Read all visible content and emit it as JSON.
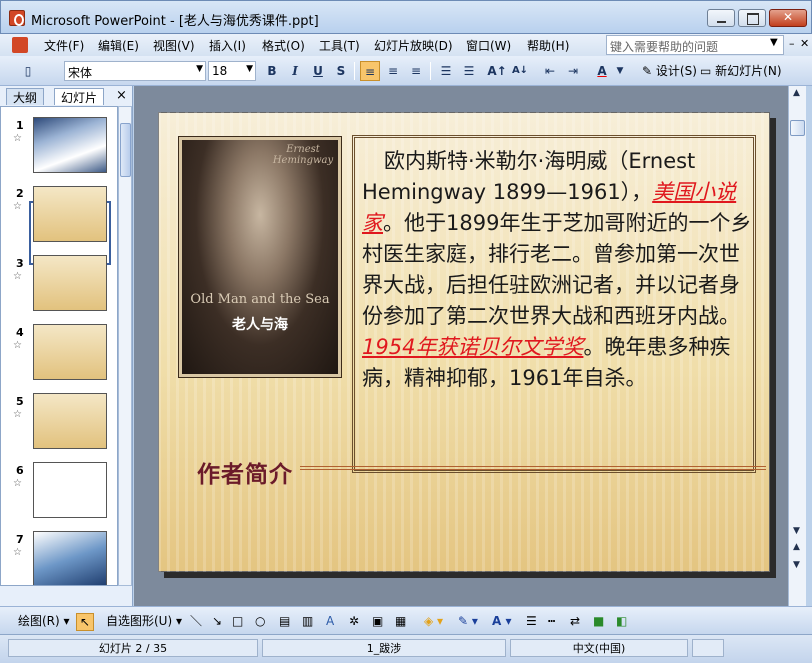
{
  "window": {
    "title": "Microsoft PowerPoint - [老人与海优秀课件.ppt]"
  },
  "menu": {
    "items": [
      "文件(F)",
      "编辑(E)",
      "视图(V)",
      "插入(I)",
      "格式(O)",
      "工具(T)",
      "幻灯片放映(D)",
      "窗口(W)",
      "帮助(H)"
    ],
    "help_placeholder": "键入需要帮助的问题"
  },
  "toolbar": {
    "font_name": "宋体",
    "font_size": "18",
    "bold": "B",
    "italic": "I",
    "underline": "U",
    "shadow": "S",
    "design_label": "设计(S)",
    "new_slide_label": "新幻灯片(N)"
  },
  "panel": {
    "tab_outline": "大纲",
    "tab_slides": "幻灯片",
    "close": "×",
    "thumbnails": [
      {
        "number": "1"
      },
      {
        "number": "2"
      },
      {
        "number": "3"
      },
      {
        "number": "4"
      },
      {
        "number": "5"
      },
      {
        "number": "6"
      },
      {
        "number": "7"
      }
    ],
    "selected": "2"
  },
  "slide": {
    "book": {
      "small_title": "Ernest Hemingway",
      "en_title": "Old Man and the Sea",
      "cn_title": "老人与海"
    },
    "body_part1": "欧内斯特·米勒尔·海明威（Ernest Hemingway 1899—1961），",
    "body_red1": "美国小说家",
    "body_part2": "。他于1899年生于芝加哥附近的一个乡村医生家庭，排行老二。曾参加第一次世界大战，后担任驻欧洲记者，并以记者身份参加了第二次世界大战和西班牙内战。",
    "body_red2": "1954年获诺贝尔文学奖",
    "body_part3": "。晚年患多种疾病，精神抑郁，1961年自杀。",
    "section_title": "作者简介"
  },
  "drawbar": {
    "draw_label": "绘图(R)",
    "autoshape_label": "自选图形(U)"
  },
  "status": {
    "slide_info": "幻灯片 2 / 35",
    "template": "1_跋涉",
    "language": "中文(中国)"
  },
  "colors": {
    "accent_red": "#e0181e",
    "section_title": "#6b1b2a"
  }
}
